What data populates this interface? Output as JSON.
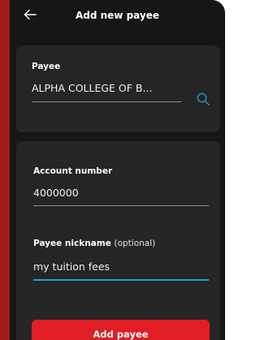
{
  "header": {
    "title": "Add new payee",
    "back_icon": "arrow-left-icon"
  },
  "payee_card": {
    "label": "Payee",
    "value": "ALPHA COLLEGE OF B...",
    "search_icon": "search-icon"
  },
  "account_card": {
    "account_label": "Account number",
    "account_value": "4000000",
    "nickname_label": "Payee nickname",
    "nickname_optional": "(optional)",
    "nickname_value": "my tuition fees"
  },
  "actions": {
    "add_button_label": "Add payee"
  },
  "colors": {
    "background": "#161616",
    "card": "#252525",
    "accent_underline": "#1fa3cf",
    "primary_button": "#e11d25",
    "side_strip": "#9e1c1c"
  }
}
